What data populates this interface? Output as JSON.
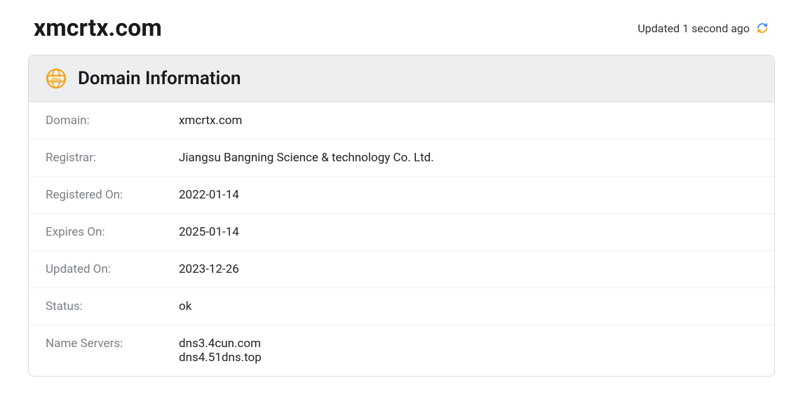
{
  "header": {
    "domain_title": "xmcrtx.com",
    "updated_text": "Updated 1 second ago"
  },
  "card": {
    "title": "Domain Information",
    "rows": [
      {
        "label": "Domain:",
        "value": "xmcrtx.com"
      },
      {
        "label": "Registrar:",
        "value": "Jiangsu Bangning Science & technology Co. Ltd."
      },
      {
        "label": "Registered On:",
        "value": "2022-01-14"
      },
      {
        "label": "Expires On:",
        "value": "2025-01-14"
      },
      {
        "label": "Updated On:",
        "value": "2023-12-26"
      },
      {
        "label": "Status:",
        "value": "ok"
      },
      {
        "label": "Name Servers:",
        "value": "dns3.4cun.com\ndns4.51dns.top"
      }
    ]
  }
}
